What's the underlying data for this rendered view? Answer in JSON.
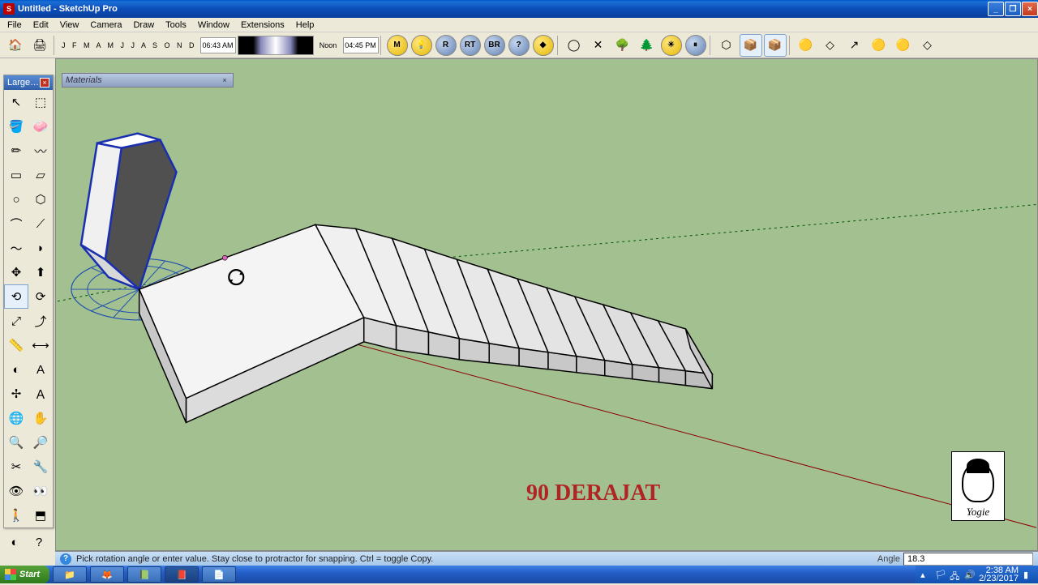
{
  "title": "Untitled - SketchUp Pro",
  "menu": [
    "File",
    "Edit",
    "View",
    "Camera",
    "Draw",
    "Tools",
    "Window",
    "Extensions",
    "Help"
  ],
  "shadow": {
    "months": "J F M A M J J A S O N D",
    "time_left": "06:43 AM",
    "noon": "Noon",
    "time_right": "04:45 PM"
  },
  "round_buttons": [
    "M",
    "R",
    "RT",
    "BR",
    "?",
    "◆"
  ],
  "toolpanel_title": "Large T…",
  "materials_title": "Materials",
  "overlay_text": "90 DERAJAT",
  "watermark_sig": "Yogie",
  "status": {
    "message": "Pick rotation angle or enter value. Stay close to protractor for snapping. Ctrl = toggle Copy.",
    "vcb_label": "Angle",
    "vcb_value": "18.3"
  },
  "taskbar": {
    "start": "Start",
    "time": "2:38 AM",
    "date": "2/23/2017"
  },
  "tool_icons": [
    "↖",
    "⬚",
    "✎",
    "🧽",
    "✏",
    "〰",
    "▭",
    "▱",
    "○",
    "◐",
    "〜",
    "⟋",
    "↔",
    "◆",
    "⟲",
    "⟳",
    "📋",
    "⤴",
    "📏",
    "A",
    "✢",
    "👤",
    "🌐",
    "✋",
    "🔍",
    "🔎",
    "✂",
    "🔧",
    "👁",
    "👁"
  ],
  "right_tool_icons": [
    "🟡",
    "◇",
    "↗",
    "🟡",
    "🟡",
    "◇"
  ]
}
